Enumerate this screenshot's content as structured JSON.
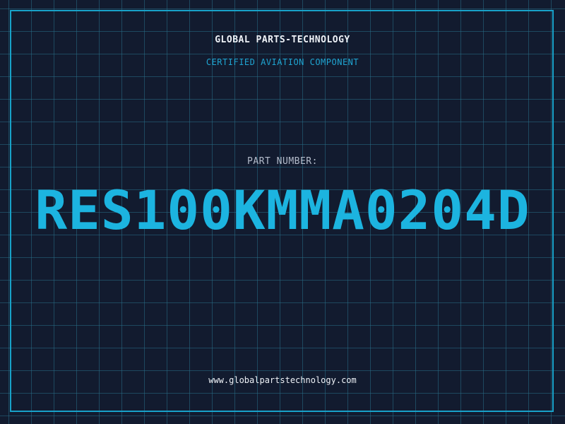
{
  "header": {
    "company": "GLOBAL PARTS-TECHNOLOGY",
    "subtitle": "CERTIFIED AVIATION COMPONENT"
  },
  "part": {
    "label": "PART NUMBER:",
    "number": "RES100KMMA0204D"
  },
  "footer": {
    "website": "www.globalpartstechnology.com"
  },
  "colors": {
    "background": "#121b2f",
    "grid": "#286e87",
    "accent": "#1cb4e0",
    "frame": "#18a2c9",
    "label": "#b4bccb",
    "text": "#eef2f7"
  }
}
